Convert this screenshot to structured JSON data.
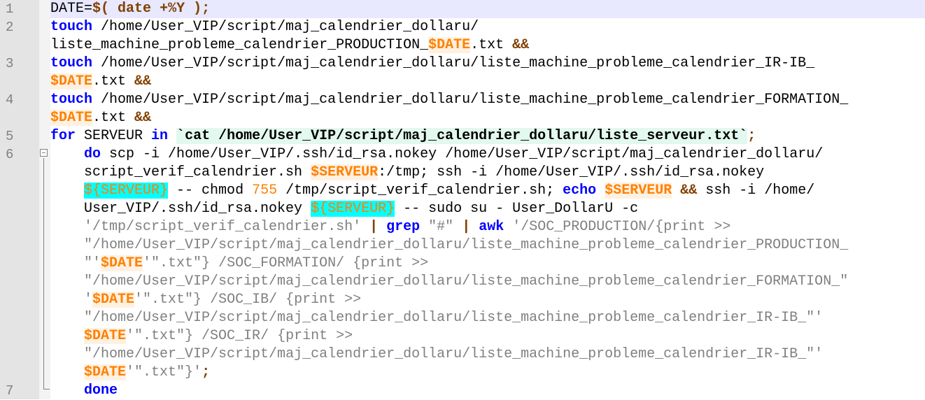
{
  "editor": {
    "line_numbers": [
      "1",
      "2",
      "3",
      "4",
      "5",
      "6",
      "7"
    ],
    "lines": [
      {
        "segments": [
          {
            "t": "DATE=",
            "c": "t"
          },
          {
            "t": "$(",
            "c": "op"
          },
          {
            "t": " ",
            "c": "t"
          },
          {
            "t": "date",
            "c": "op"
          },
          {
            "t": " ",
            "c": "t"
          },
          {
            "t": "+%Y",
            "c": "op"
          },
          {
            "t": " ",
            "c": "t"
          },
          {
            "t": ");",
            "c": "op"
          }
        ]
      },
      {
        "segments": [
          {
            "t": "touch",
            "c": "kw"
          },
          {
            "t": " /home/User_VIP/script/maj_calendrier_dollaru/",
            "c": "t"
          }
        ]
      },
      {
        "segments": [
          {
            "t": "liste_machine_probleme_calendrier_PRODUCTION_",
            "c": "t"
          },
          {
            "t": "$DATE",
            "c": "var"
          },
          {
            "t": ".txt ",
            "c": "t"
          },
          {
            "t": "&&",
            "c": "op"
          }
        ]
      },
      {
        "segments": [
          {
            "t": "touch",
            "c": "kw"
          },
          {
            "t": " /home/User_VIP/script/maj_calendrier_dollaru/liste_machine_probleme_calendrier_IR-IB_",
            "c": "t"
          }
        ]
      },
      {
        "segments": [
          {
            "t": "$DATE",
            "c": "var"
          },
          {
            "t": ".txt ",
            "c": "t"
          },
          {
            "t": "&&",
            "c": "op"
          }
        ]
      },
      {
        "segments": [
          {
            "t": "touch",
            "c": "kw"
          },
          {
            "t": " /home/User_VIP/script/maj_calendrier_dollaru/liste_machine_probleme_calendrier_FORMATION_",
            "c": "t"
          }
        ]
      },
      {
        "segments": [
          {
            "t": "$DATE",
            "c": "var"
          },
          {
            "t": ".txt ",
            "c": "t"
          },
          {
            "t": "&&",
            "c": "op"
          }
        ]
      },
      {
        "segments": [
          {
            "t": "for",
            "c": "kw"
          },
          {
            "t": " SERVEUR ",
            "c": "t"
          },
          {
            "t": "in",
            "c": "kw"
          },
          {
            "t": " ",
            "c": "t"
          },
          {
            "t": "`cat /home/User_VIP/script/maj_calendrier_dollaru/liste_serveur.txt`",
            "c": "bt"
          },
          {
            "t": ";",
            "c": "op"
          }
        ]
      },
      {
        "segments": [
          {
            "t": "    ",
            "c": "t"
          },
          {
            "t": "do",
            "c": "kw"
          },
          {
            "t": " scp -i /home/User_VIP/.ssh/id_rsa.nokey /home/User_VIP/script/maj_calendrier_dollaru/",
            "c": "t"
          }
        ]
      },
      {
        "segments": [
          {
            "t": "    script_verif_calendrier.sh ",
            "c": "t"
          },
          {
            "t": "$SERVEUR",
            "c": "var"
          },
          {
            "t": ":/tmp; ssh -i /home/User_VIP/.ssh/id_rsa.nokey",
            "c": "t"
          }
        ]
      },
      {
        "segments": [
          {
            "t": "    ",
            "c": "t"
          },
          {
            "t": "${SERVEUR}",
            "c": "vhl"
          },
          {
            "t": " -- chmod ",
            "c": "t"
          },
          {
            "t": "755",
            "c": "num"
          },
          {
            "t": " /tmp/script_verif_calendrier.sh; ",
            "c": "t"
          },
          {
            "t": "echo",
            "c": "kw"
          },
          {
            "t": " ",
            "c": "t"
          },
          {
            "t": "$SERVEUR",
            "c": "var"
          },
          {
            "t": " ",
            "c": "t"
          },
          {
            "t": "&&",
            "c": "op"
          },
          {
            "t": " ssh -i /home/",
            "c": "t"
          }
        ]
      },
      {
        "segments": [
          {
            "t": "    User_VIP/.ssh/id_rsa.nokey ",
            "c": "t"
          },
          {
            "t": "${SERVEUR}",
            "c": "vhl"
          },
          {
            "t": " -- sudo su - User_DollarU -c",
            "c": "t"
          }
        ]
      },
      {
        "segments": [
          {
            "t": "    ",
            "c": "t"
          },
          {
            "t": "'/tmp/script_verif_calendrier.sh'",
            "c": "str"
          },
          {
            "t": " ",
            "c": "t"
          },
          {
            "t": "|",
            "c": "op"
          },
          {
            "t": " ",
            "c": "t"
          },
          {
            "t": "grep",
            "c": "kw"
          },
          {
            "t": " ",
            "c": "t"
          },
          {
            "t": "\"#\"",
            "c": "str"
          },
          {
            "t": " ",
            "c": "t"
          },
          {
            "t": "|",
            "c": "op"
          },
          {
            "t": " ",
            "c": "t"
          },
          {
            "t": "awk",
            "c": "kw"
          },
          {
            "t": " ",
            "c": "t"
          },
          {
            "t": "'/SOC_PRODUCTION/{print >>",
            "c": "str"
          }
        ]
      },
      {
        "segments": [
          {
            "t": "    ",
            "c": "t"
          },
          {
            "t": "\"/home/User_VIP/script/maj_calendrier_dollaru/liste_machine_probleme_calendrier_PRODUCTION_",
            "c": "str"
          }
        ]
      },
      {
        "segments": [
          {
            "t": "    ",
            "c": "t"
          },
          {
            "t": "\"'",
            "c": "str"
          },
          {
            "t": "$DATE",
            "c": "var"
          },
          {
            "t": "'\".txt\"} /SOC_FORMATION/ {print >>",
            "c": "str"
          }
        ]
      },
      {
        "segments": [
          {
            "t": "    ",
            "c": "t"
          },
          {
            "t": "\"/home/User_VIP/script/maj_calendrier_dollaru/liste_machine_probleme_calendrier_FORMATION_\"",
            "c": "str"
          }
        ]
      },
      {
        "segments": [
          {
            "t": "    ",
            "c": "t"
          },
          {
            "t": "'",
            "c": "str"
          },
          {
            "t": "$DATE",
            "c": "var"
          },
          {
            "t": "'\".txt\"} /SOC_IB/ {print >>",
            "c": "str"
          }
        ]
      },
      {
        "segments": [
          {
            "t": "    ",
            "c": "t"
          },
          {
            "t": "\"/home/User_VIP/script/maj_calendrier_dollaru/liste_machine_probleme_calendrier_IR-IB_\"'",
            "c": "str"
          }
        ]
      },
      {
        "segments": [
          {
            "t": "    ",
            "c": "t"
          },
          {
            "t": "$DATE",
            "c": "var"
          },
          {
            "t": "'\".txt\"} /SOC_IR/ {print >>",
            "c": "str"
          }
        ]
      },
      {
        "segments": [
          {
            "t": "    ",
            "c": "t"
          },
          {
            "t": "\"/home/User_VIP/script/maj_calendrier_dollaru/liste_machine_probleme_calendrier_IR-IB_\"'",
            "c": "str"
          }
        ]
      },
      {
        "segments": [
          {
            "t": "    ",
            "c": "t"
          },
          {
            "t": "$DATE",
            "c": "var"
          },
          {
            "t": "'\".txt\"}'",
            "c": "str"
          },
          {
            "t": ";",
            "c": "op"
          }
        ]
      },
      {
        "segments": [
          {
            "t": "    ",
            "c": "t"
          },
          {
            "t": "done",
            "c": "kw"
          }
        ]
      }
    ]
  }
}
